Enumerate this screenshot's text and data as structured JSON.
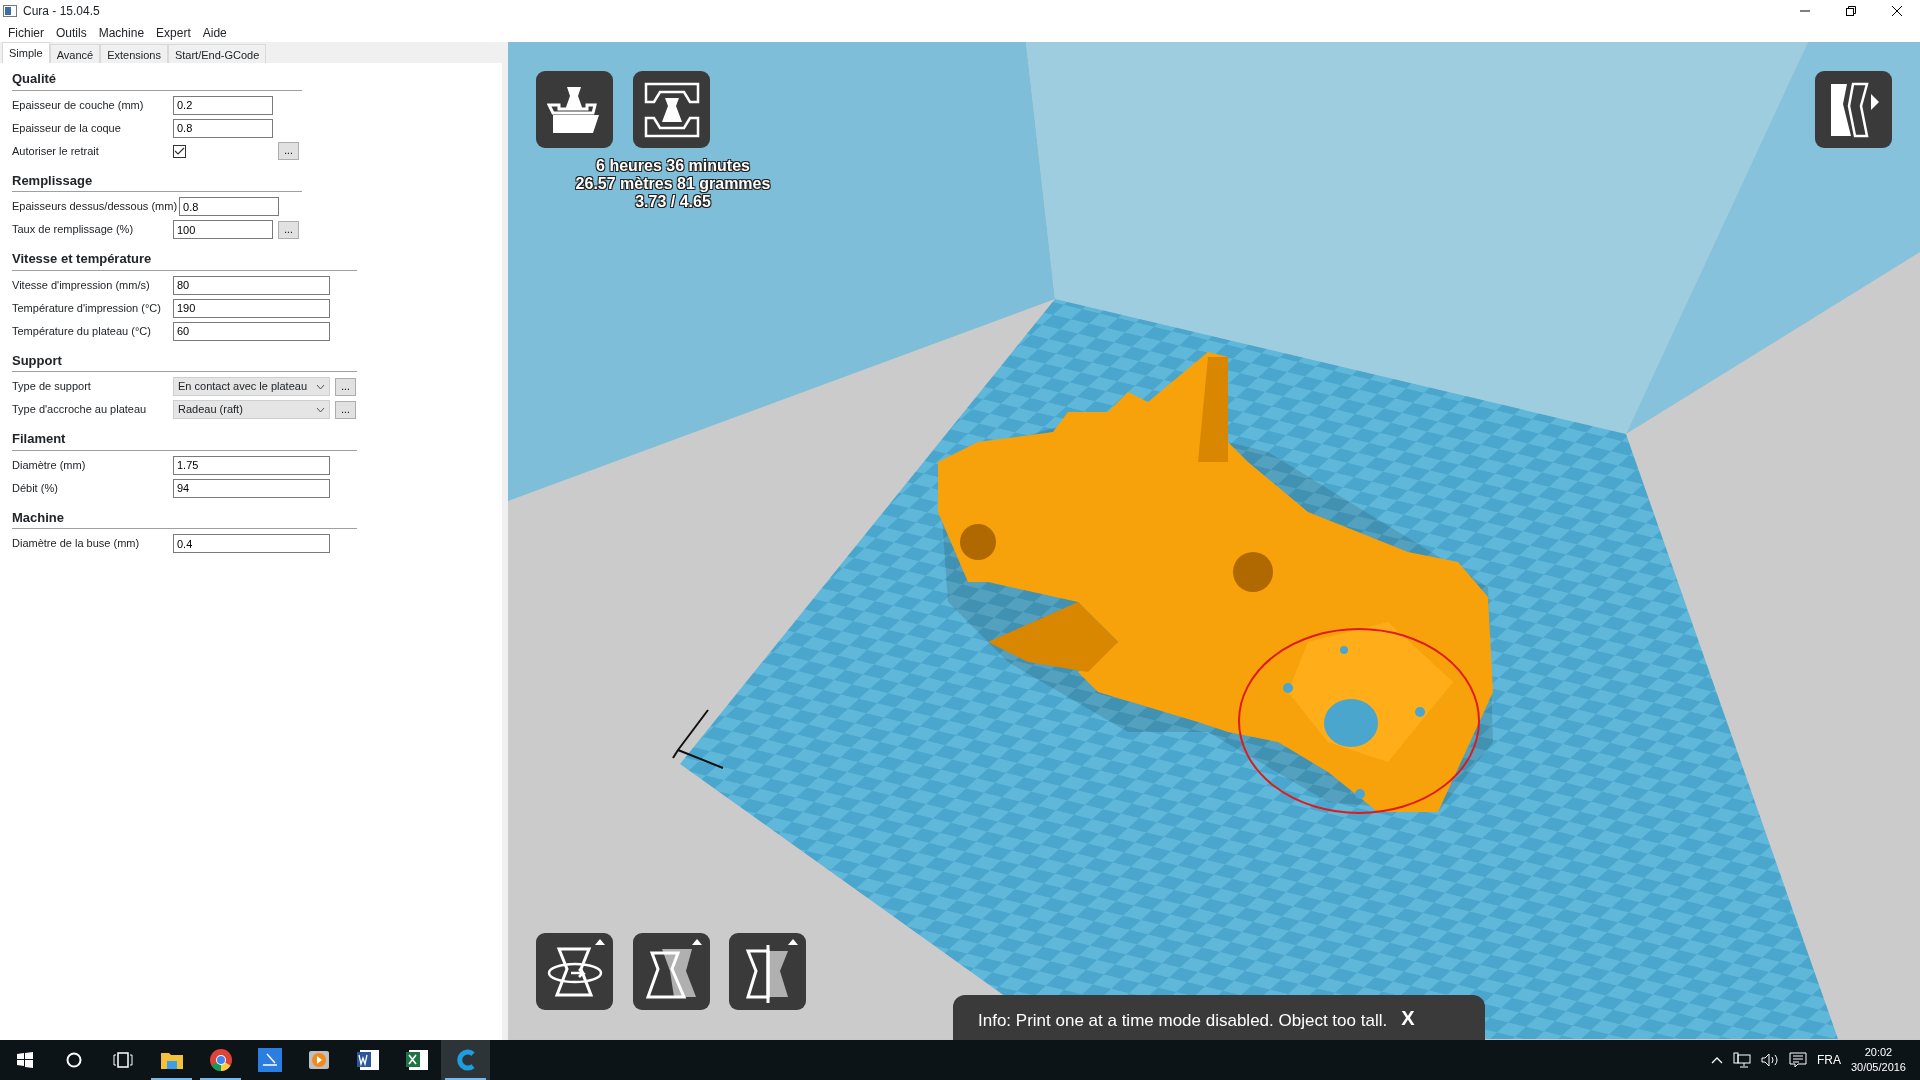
{
  "window": {
    "title": "Cura - 15.04.5"
  },
  "menu": [
    "Fichier",
    "Outils",
    "Machine",
    "Expert",
    "Aide"
  ],
  "tabs": [
    {
      "label": "Simple",
      "selected": true
    },
    {
      "label": "Avancé",
      "selected": false
    },
    {
      "label": "Extensions",
      "selected": false
    },
    {
      "label": "Start/End-GCode",
      "selected": false
    }
  ],
  "sections": [
    {
      "title": "Qualité",
      "rows": [
        {
          "kind": "text",
          "label": "Epaisseur de couche (mm)",
          "value": "0.2"
        },
        {
          "kind": "text",
          "label": "Epaisseur de la coque",
          "value": "0.8"
        },
        {
          "kind": "checkbox",
          "label": "Autoriser le retrait",
          "checked": true,
          "more": "..."
        }
      ]
    },
    {
      "title": "Remplissage",
      "rows": [
        {
          "kind": "text",
          "label": "Epaisseurs dessus/dessous (mm)",
          "value": "0.8"
        },
        {
          "kind": "text",
          "label": "Taux de remplissage (%)",
          "value": "100",
          "more": "..."
        }
      ]
    },
    {
      "title": "Vitesse et température",
      "rows": [
        {
          "kind": "text",
          "label": "Vitesse d'impression (mm/s)",
          "value": "80"
        },
        {
          "kind": "text",
          "label": "Température d'impression (°C)",
          "value": "190"
        },
        {
          "kind": "text",
          "label": "Température du plateau (°C)",
          "value": "60"
        }
      ]
    },
    {
      "title": "Support",
      "rows": [
        {
          "kind": "select",
          "label": "Type de support",
          "value": "En contact avec le plateau",
          "more": "..."
        },
        {
          "kind": "select",
          "label": "Type d'accroche au plateau",
          "value": "Radeau (raft)",
          "more": "..."
        }
      ]
    },
    {
      "title": "Filament",
      "rows": [
        {
          "kind": "text",
          "label": "Diamètre (mm)",
          "value": "1.75"
        },
        {
          "kind": "text",
          "label": "Débit (%)",
          "value": "94"
        }
      ]
    },
    {
      "title": "Machine",
      "rows": [
        {
          "kind": "text",
          "label": "Diamètre de la buse (mm)",
          "value": "0.4"
        }
      ]
    }
  ],
  "print_stats": [
    "6 heures 36 minutes",
    "26.57 mètres 81 grammes",
    "3.73 / 4.65"
  ],
  "info_bar": {
    "text": "Info: Print one at a time mode disabled. Object too tall.",
    "close": "X"
  },
  "taskbar": {
    "apps": [
      {
        "kind": "files",
        "running": true,
        "selected": false
      },
      {
        "kind": "browser",
        "running": true,
        "selected": false
      },
      {
        "kind": "scan",
        "running": false,
        "selected": false
      },
      {
        "kind": "media",
        "running": false,
        "selected": false
      },
      {
        "kind": "word",
        "running": false,
        "selected": false
      },
      {
        "kind": "excel",
        "running": false,
        "selected": false
      },
      {
        "kind": "cura",
        "running": true,
        "selected": true
      }
    ],
    "language": "FRA",
    "time": "20:02",
    "date": "30/05/2016"
  }
}
